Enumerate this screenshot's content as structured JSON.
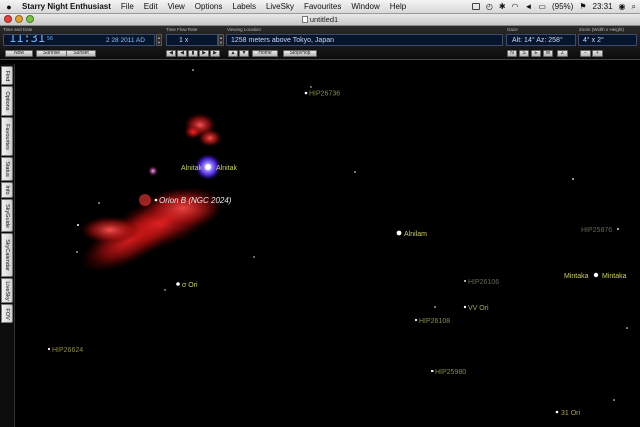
{
  "menubar": {
    "apple": "",
    "app_name": "Starry Night Enthusiast",
    "items": [
      "File",
      "Edit",
      "View",
      "Options",
      "Labels",
      "LiveSky",
      "Favourites",
      "Window",
      "Help"
    ],
    "battery": "(95%)",
    "clock": "23:31"
  },
  "window": {
    "title": "untitled1"
  },
  "toolbar": {
    "time_date": {
      "label": "Time and Date",
      "time": "11:31",
      "seconds": "56",
      "date": "2 28 2011 AD",
      "buttons": [
        "Now",
        "Sunrise",
        "Sunset"
      ]
    },
    "time_flow": {
      "label": "Time Flow Rate",
      "rate": "1 x",
      "controls": [
        "◀",
        "◀",
        "▮",
        "▶",
        "▶"
      ]
    },
    "viewing_location": {
      "label": "Viewing Location",
      "value": "1258 meters above Tokyo, Japan",
      "buttons": [
        "Home",
        "Stop/Hop"
      ]
    },
    "gaze": {
      "label": "Gaze",
      "value": "Alt: 14° Az: 258°",
      "buttons": [
        "N",
        "S",
        "E",
        "W",
        "Z"
      ]
    },
    "zoom": {
      "label": "Zoom (Width x Height)",
      "value": "4° x 2°",
      "buttons": [
        "−",
        "+"
      ]
    }
  },
  "side_tabs": [
    "Find",
    "Options",
    "Favourites",
    "Status",
    "Info",
    "SkyGuide",
    "SkyCalendar",
    "LiveSky",
    "FOV"
  ],
  "sky": {
    "labels": [
      {
        "id": "hip26736",
        "text": "HIP26736",
        "color": "#8a8a4a"
      },
      {
        "id": "alnitak-1",
        "text": "Alnitak",
        "color": "#c9cf6a"
      },
      {
        "id": "alnitak-2",
        "text": "Alnitak",
        "color": "#c9cf6a"
      },
      {
        "id": "orion-b",
        "text": "Orion B (NGC 2024)",
        "color": "#e8e8e8"
      },
      {
        "id": "alnilam",
        "text": "Alnilam",
        "color": "#c9cf6a"
      },
      {
        "id": "hip25876",
        "text": "HIP25876",
        "color": "#666655"
      },
      {
        "id": "hip26106",
        "text": "HIP26106",
        "color": "#666655"
      },
      {
        "id": "mintaka-1",
        "text": "Mintaka",
        "color": "#c9cf6a"
      },
      {
        "id": "mintaka-2",
        "text": "Mintaka",
        "color": "#c9cf6a"
      },
      {
        "id": "sigma-ori",
        "text": "σ Ori",
        "color": "#c9cf6a"
      },
      {
        "id": "vv-ori",
        "text": "VV Ori",
        "color": "#a5a55a"
      },
      {
        "id": "hip26108",
        "text": "HIP26108",
        "color": "#8a8a4a"
      },
      {
        "id": "hip26624",
        "text": "HIP26624",
        "color": "#8a8a4a"
      },
      {
        "id": "hip25980",
        "text": "HIP25980",
        "color": "#8a8a4a"
      },
      {
        "id": "31-ori",
        "text": "31 Ori",
        "color": "#a5a55a"
      }
    ]
  }
}
